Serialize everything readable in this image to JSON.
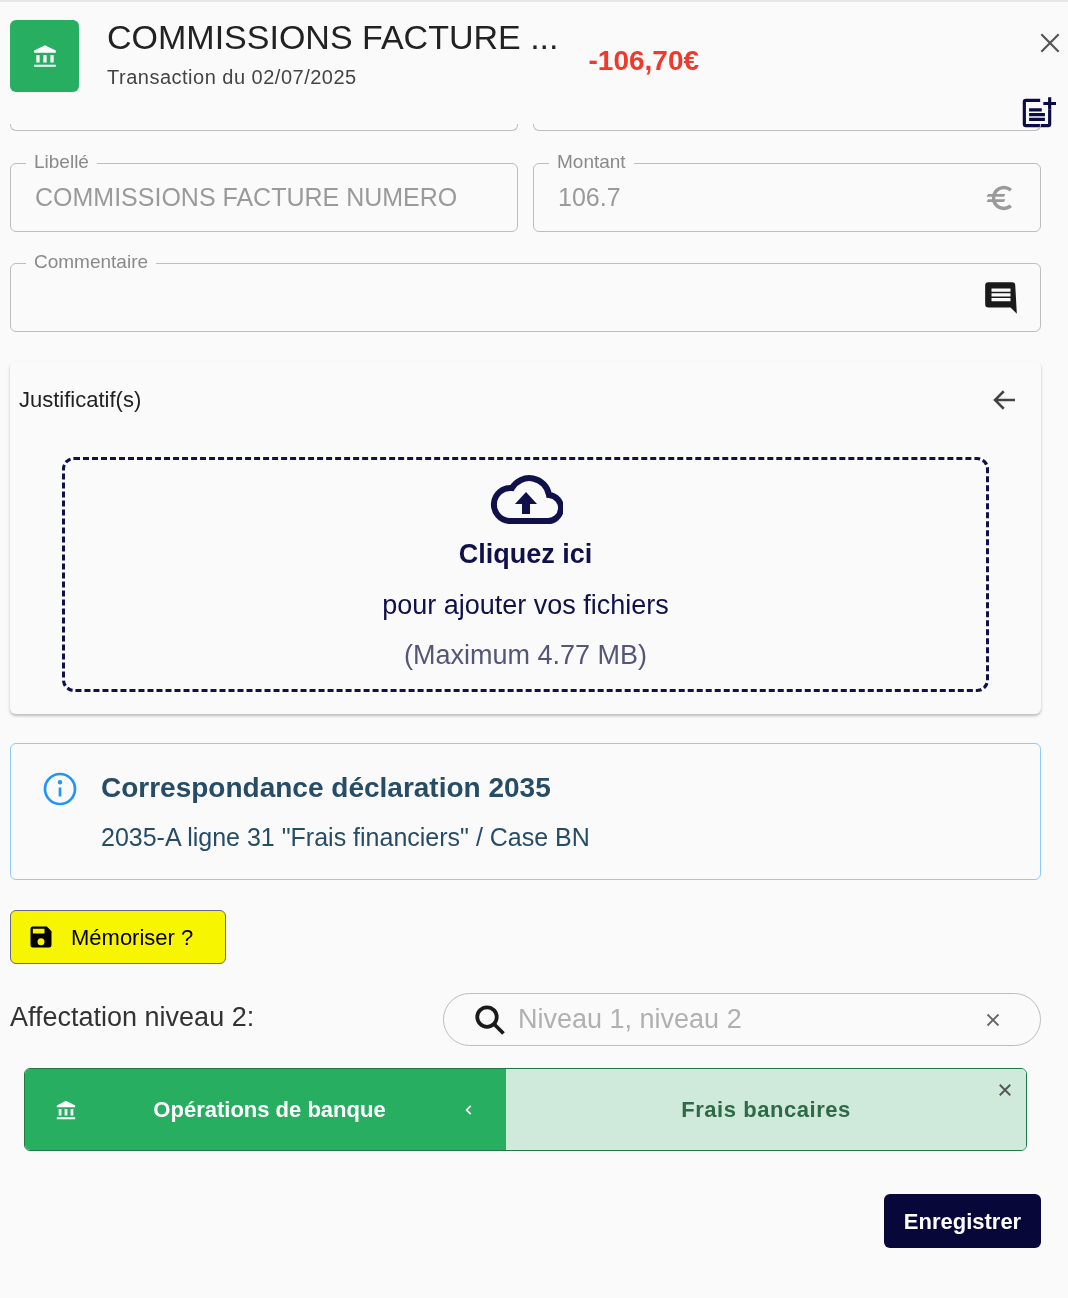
{
  "header": {
    "title": "COMMISSIONS FACTURE ...",
    "subtitle": "Transaction du 02/07/2025",
    "amount": "-106,70€"
  },
  "fields": [
    {
      "kind": "text",
      "label": "Libellé",
      "value": "COMMISSIONS FACTURE NUMERO"
    },
    {
      "kind": "amount",
      "label": "Montant",
      "value": "106.7"
    },
    {
      "kind": "comment",
      "label": "Commentaire"
    }
  ],
  "attachments": {
    "title": "Justificatif(s)",
    "upload_title": "Cliquez ici",
    "upload_text": "pour ajouter vos fichiers",
    "upload_limit": "(Maximum 4.77 MB)"
  },
  "info": {
    "title": "Correspondance déclaration 2035",
    "text": "2035-A ligne 31 \"Frais financiers\" / Case BN"
  },
  "memorize_button": {
    "label": "Mémoriser ?",
    "highlighted": true
  },
  "assignment": {
    "label": "Affectation niveau 2:",
    "search": {
      "placeholder": "Niveau 1, niveau 2"
    },
    "category": "Opérations de banque",
    "subcategory": "Frais bancaires"
  },
  "save_button": "Enregistrer"
}
